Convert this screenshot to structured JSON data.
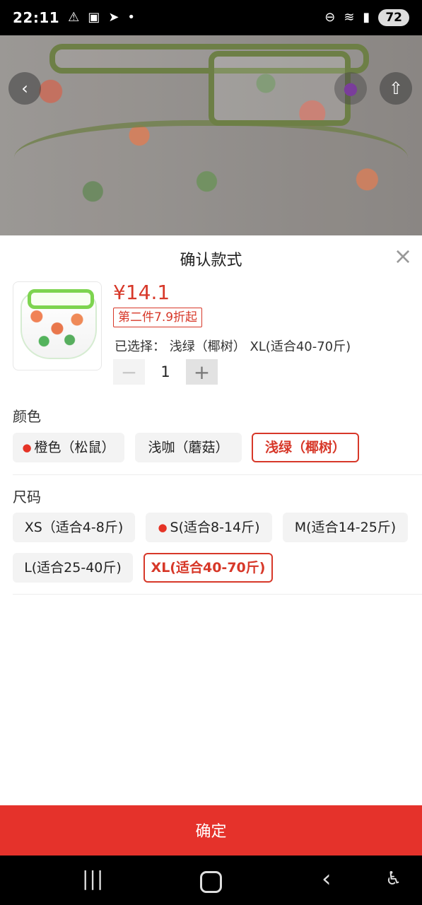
{
  "status_bar": {
    "time": "22:11",
    "icons": [
      "warning-icon",
      "scan-icon",
      "telegram-icon",
      "dot-icon",
      "do-not-disturb-icon",
      "wifi-icon",
      "signal-icon"
    ],
    "battery": "72"
  },
  "sheet": {
    "title": "确认款式",
    "close_icon": "×",
    "price": "¥14.1",
    "promo": "第二件7.9折起",
    "selected_summary": "已选择：  浅绿（椰树）  XL(适合40-70斤)",
    "quantity": {
      "minus": "−",
      "value": "1",
      "plus": "+"
    },
    "color_section": {
      "title": "颜色",
      "options": [
        {
          "label": "橙色（松鼠）",
          "hot": true,
          "selected": false
        },
        {
          "label": "浅咖（蘑菇）",
          "hot": false,
          "selected": false
        },
        {
          "label": "浅绿（椰树）",
          "hot": false,
          "selected": true
        }
      ]
    },
    "size_section": {
      "title": "尺码",
      "options": [
        {
          "label": "XS（适合4-8斤)",
          "hot": false,
          "selected": false
        },
        {
          "label": "S(适合8-14斤)",
          "hot": true,
          "selected": false
        },
        {
          "label": "M(适合14-25斤)",
          "hot": false,
          "selected": false
        },
        {
          "label": "L(适合25-40斤)",
          "hot": false,
          "selected": false
        },
        {
          "label": "XL(适合40-70斤)",
          "hot": false,
          "selected": true
        }
      ]
    },
    "confirm_button": "确定"
  },
  "hero": {
    "back_icon": "‹",
    "favorite_icon": "●",
    "share_icon": "⇧"
  },
  "nav_bar": {
    "recent_icon": "|||",
    "back_icon": "‹",
    "accessibility_icon": "♿"
  },
  "colors": {
    "accent": "#e5322b",
    "text": "#222222",
    "muted": "#999999",
    "option_bg": "#f3f3f3"
  }
}
